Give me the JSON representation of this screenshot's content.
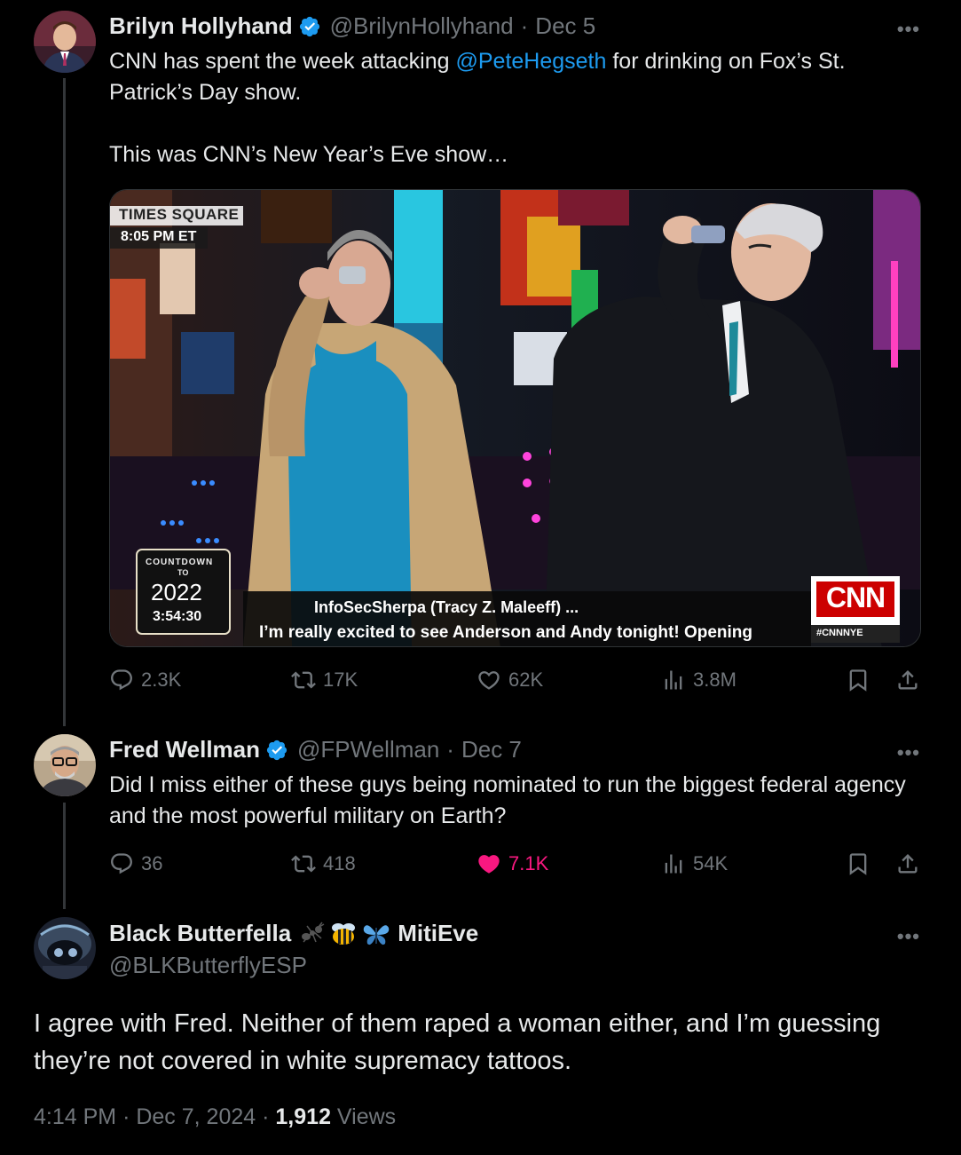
{
  "tweets": [
    {
      "name": "Brilyn Hollyhand",
      "handle": "@BrilynHollyhand",
      "dot": "·",
      "date": "Dec 5",
      "text_pre": "CNN has spent the week attacking ",
      "mention": "@PeteHegseth",
      "text_post": " for drinking on Fox’s St. Patrick’s Day show.\n\nThis was CNN’s New Year’s Eve show…",
      "media": {
        "location_label": "TIMES SQUARE",
        "time_label": "8:05 PM ET",
        "countdown_label": "COUNTDOWN",
        "countdown_to": "TO",
        "countdown_year": "2022",
        "countdown_time": "3:54:30",
        "ticker_user": "InfoSecSherpa (Tracy Z. Maleeff) ...",
        "ticker_text": "I’m really excited to see Anderson and Andy tonight! Opening",
        "network": "CNN",
        "hashtag": "#CNNNYE"
      },
      "replies": "2.3K",
      "reposts": "17K",
      "likes": "62K",
      "views": "3.8M"
    },
    {
      "name": "Fred Wellman",
      "handle": "@FPWellman",
      "dot": "·",
      "date": "Dec 7",
      "text": "Did I miss either of these guys being nominated to run the biggest federal agency and the most powerful military on Earth?",
      "replies": "36",
      "reposts": "418",
      "likes": "7.1K",
      "views": "54K"
    }
  ],
  "main_tweet": {
    "name": "Black Butterfella",
    "name_suffix": "MitiEve",
    "emojis": [
      "ant-icon",
      "bee-icon",
      "butterfly-icon"
    ],
    "handle": "@BLKButterflyESP",
    "text": "I agree with Fred. Neither of them raped a woman either, and I’m guessing they’re not covered in white supremacy tattoos.",
    "time": "4:14 PM",
    "date": "Dec 7, 2024",
    "sep": "·",
    "views_count": "1,912",
    "views_label": "Views"
  },
  "more_label": "•••",
  "colors": {
    "accent": "#1d9bf0",
    "like": "#f91880",
    "muted": "#71767b"
  }
}
